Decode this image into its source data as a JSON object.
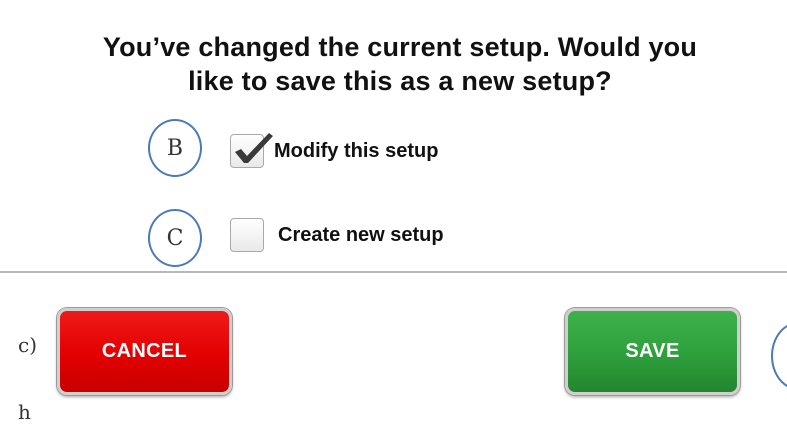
{
  "dialog": {
    "title_line1": "You’ve changed the current setup. Would you",
    "title_line2": "like to save this as a new setup?"
  },
  "callouts": {
    "b": "B",
    "c": "C",
    "d": ""
  },
  "options": [
    {
      "label": "Modify this setup",
      "checked": true,
      "icon": "checkmark-icon"
    },
    {
      "label": "Create new setup",
      "checked": false
    }
  ],
  "buttons": {
    "cancel_label": "CANCEL",
    "save_label": "SAVE"
  },
  "edge_glyphs": [
    "c)",
    "h"
  ],
  "colors": {
    "cancel": "#e30000",
    "save": "#2e9f3c",
    "callout_border": "#4a7ab8",
    "divider": "#b8b8b8"
  }
}
